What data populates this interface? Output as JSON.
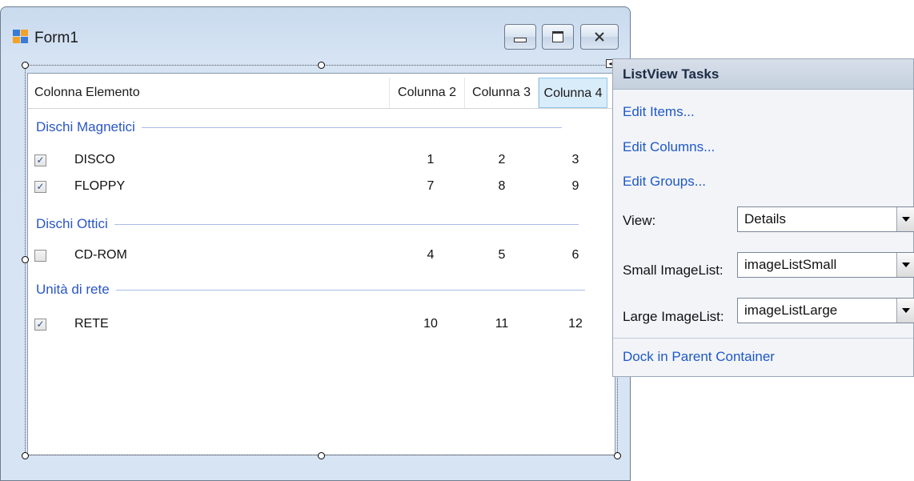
{
  "window": {
    "title": "Form1"
  },
  "listview": {
    "columns": [
      "Colonna Elemento",
      "Colunna 2",
      "Colunna 3",
      "Colunna 4"
    ],
    "groups": [
      {
        "name": "Dischi Magnetici",
        "rows": [
          {
            "checked": true,
            "name": "DISCO",
            "v2": "1",
            "v3": "2",
            "v4": "3"
          },
          {
            "checked": true,
            "name": "FLOPPY",
            "v2": "7",
            "v3": "8",
            "v4": "9"
          }
        ]
      },
      {
        "name": "Dischi Ottici",
        "rows": [
          {
            "checked": false,
            "name": "CD-ROM",
            "v2": "4",
            "v3": "5",
            "v4": "6"
          }
        ]
      },
      {
        "name": "Unità di rete",
        "rows": [
          {
            "checked": true,
            "name": "RETE",
            "v2": "10",
            "v3": "11",
            "v4": "12"
          }
        ]
      }
    ]
  },
  "tasks": {
    "title": "ListView Tasks",
    "links": {
      "edit_items": "Edit Items...",
      "edit_columns": "Edit Columns...",
      "edit_groups": "Edit Groups...",
      "dock": "Dock in Parent Container"
    },
    "view": {
      "label": "View:",
      "value": "Details"
    },
    "small_imagelist": {
      "label": "Small ImageList:",
      "value": "imageListSmall"
    },
    "large_imagelist": {
      "label": "Large ImageList:",
      "value": "imageListLarge"
    }
  },
  "colors": {
    "link": "#1f58c7",
    "group_header": "#2a56c6",
    "selected_column_bg": "#d9ecfa"
  }
}
